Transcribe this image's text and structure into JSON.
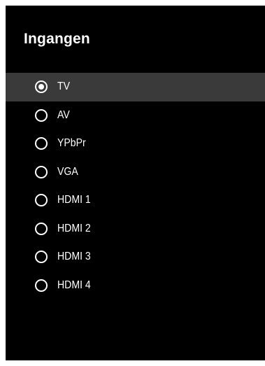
{
  "menu": {
    "title": "Ingangen",
    "selected_index": 0,
    "items": [
      {
        "label": "TV",
        "selected": true
      },
      {
        "label": "AV",
        "selected": false
      },
      {
        "label": "YPbPr",
        "selected": false
      },
      {
        "label": "VGA",
        "selected": false
      },
      {
        "label": "HDMI 1",
        "selected": false
      },
      {
        "label": "HDMI 2",
        "selected": false
      },
      {
        "label": "HDMI 3",
        "selected": false
      },
      {
        "label": "HDMI 4",
        "selected": false
      }
    ]
  },
  "colors": {
    "panel_background": "#000000",
    "selected_row": "#3a3a3a",
    "text": "#ffffff"
  }
}
